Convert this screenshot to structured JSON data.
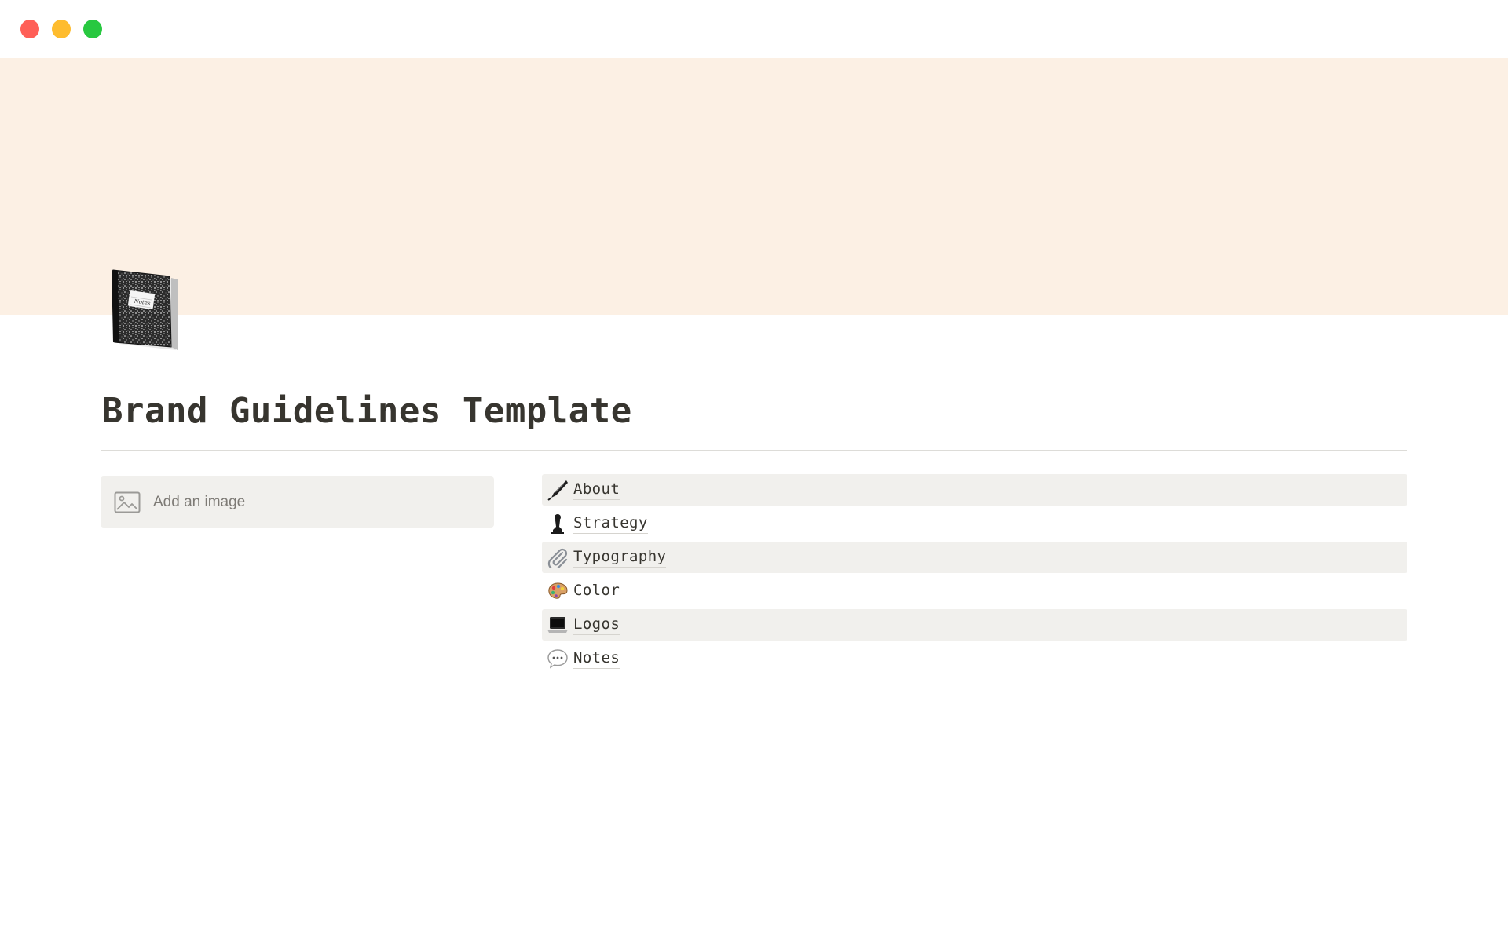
{
  "window": {
    "controls": [
      "close",
      "minimize",
      "zoom"
    ]
  },
  "colors": {
    "cover": "#fcf0e4",
    "title_text": "#37352f",
    "shaded_row": "#f1f0ed",
    "traffic_close": "#ff5f57",
    "traffic_minimize": "#febc2e",
    "traffic_zoom": "#28c840"
  },
  "page": {
    "icon": "notebook-icon",
    "icon_label": "Notes",
    "title": "Brand Guidelines Template"
  },
  "image_block": {
    "icon": "image-icon",
    "label": "Add an image"
  },
  "nav": {
    "items": [
      {
        "label": "About",
        "icon": "fountain-pen-icon",
        "shaded": true
      },
      {
        "label": "Strategy",
        "icon": "chess-pawn-icon",
        "shaded": false
      },
      {
        "label": "Typography",
        "icon": "paperclip-icon",
        "shaded": true
      },
      {
        "label": "Color",
        "icon": "palette-icon",
        "shaded": false
      },
      {
        "label": "Logos",
        "icon": "laptop-icon",
        "shaded": true
      },
      {
        "label": "Notes",
        "icon": "speech-bubble-icon",
        "shaded": false
      }
    ]
  }
}
